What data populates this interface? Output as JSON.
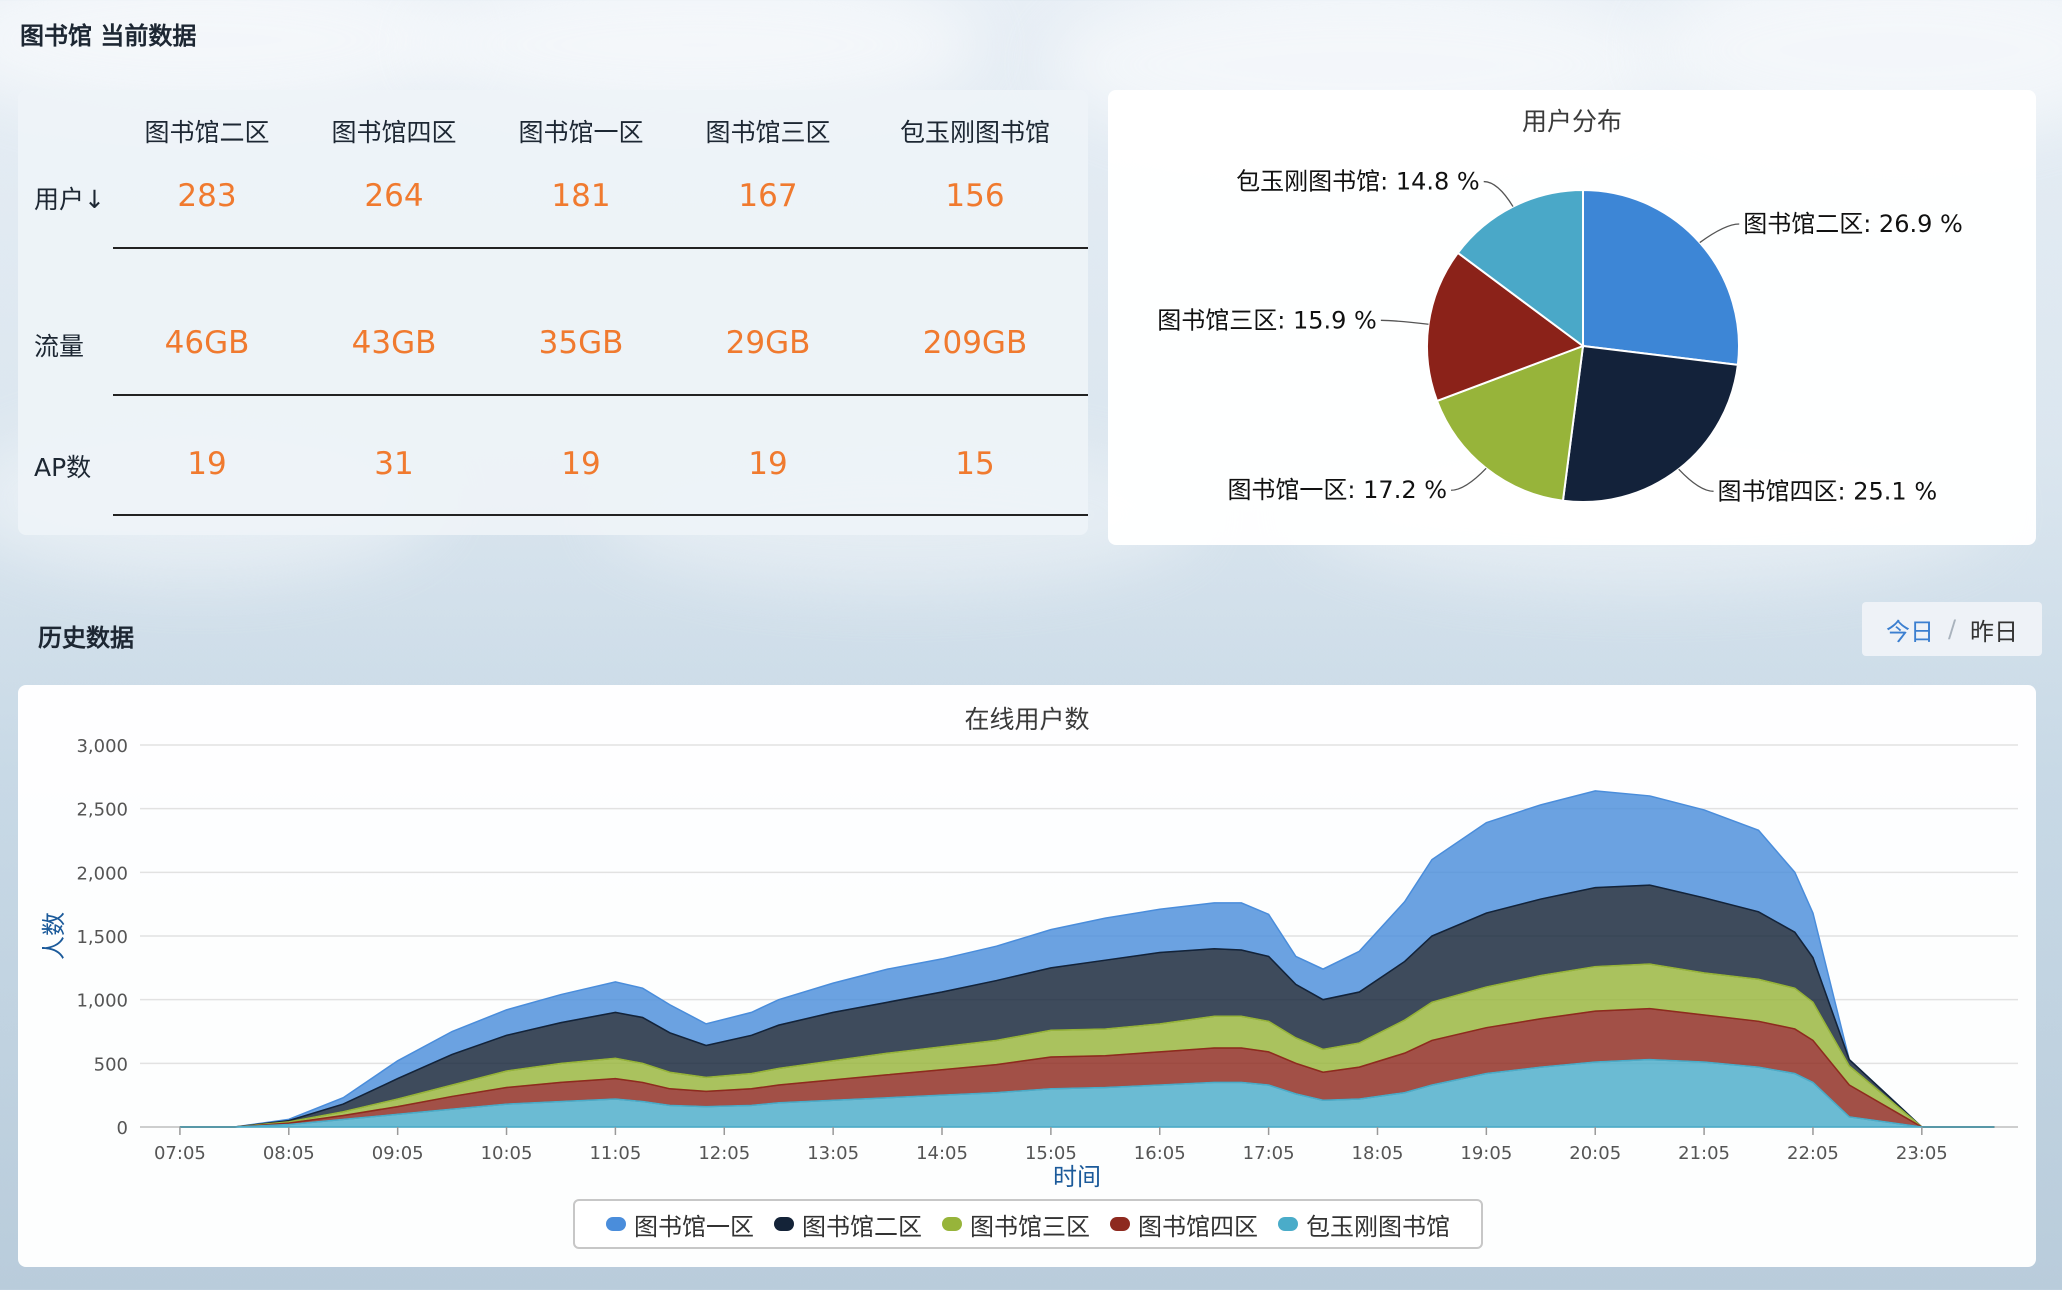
{
  "header": {
    "current_title": "图书馆 当前数据",
    "history_title": "历史数据"
  },
  "stats": {
    "columns": [
      "图书馆二区",
      "图书馆四区",
      "图书馆一区",
      "图书馆三区",
      "包玉刚图书馆"
    ],
    "rows": [
      {
        "label": "用户↓",
        "values": [
          "283",
          "264",
          "181",
          "167",
          "156"
        ]
      },
      {
        "label": "流量",
        "values": [
          "46GB",
          "43GB",
          "35GB",
          "29GB",
          "209GB"
        ]
      },
      {
        "label": "AP数",
        "values": [
          "19",
          "31",
          "19",
          "19",
          "15"
        ]
      }
    ]
  },
  "toggle": {
    "today": "今日",
    "sep": "/",
    "yesterday": "昨日"
  },
  "colors": {
    "图书馆一区": "#4a8ddb",
    "图书馆二区": "#142338",
    "图书馆三区": "#97b43a",
    "图书馆四区": "#8e2a1f",
    "包玉刚图书馆": "#4aacc9"
  },
  "chart_data": [
    {
      "type": "pie",
      "title": "用户分布",
      "labels": [
        "图书馆二区",
        "图书馆四区",
        "图书馆一区",
        "图书馆三区",
        "包玉刚图书馆"
      ],
      "values": [
        26.9,
        25.1,
        17.2,
        15.9,
        14.8
      ],
      "label_texts": [
        "图书馆二区: 26.9 %",
        "图书馆四区: 25.1 %",
        "图书馆一区: 17.2 %",
        "图书馆三区: 15.9 %",
        "包玉刚图书馆: 14.8 %"
      ],
      "colors": [
        "#3d86d6",
        "#13223a",
        "#97b43a",
        "#8b2219",
        "#4aa8c8"
      ]
    },
    {
      "type": "area",
      "stacked": true,
      "title": "在线用户数",
      "xlabel": "时间",
      "ylabel": "人数",
      "ylim": [
        0,
        3000
      ],
      "yticks": [
        0,
        500,
        1000,
        1500,
        2000,
        2500,
        3000
      ],
      "ytick_labels": [
        "0",
        "500",
        "1,000",
        "1,500",
        "2,000",
        "2,500",
        "3,000"
      ],
      "x_tick_labels": [
        "07:05",
        "08:05",
        "09:05",
        "10:05",
        "11:05",
        "12:05",
        "13:05",
        "14:05",
        "15:05",
        "16:05",
        "17:05",
        "18:05",
        "19:05",
        "20:05",
        "21:05",
        "22:05",
        "23:05"
      ],
      "x": [
        "07:05",
        "07:35",
        "08:05",
        "08:35",
        "09:05",
        "09:35",
        "10:05",
        "10:35",
        "11:05",
        "11:20",
        "11:35",
        "11:55",
        "12:20",
        "12:35",
        "13:05",
        "13:35",
        "14:05",
        "14:35",
        "15:05",
        "15:35",
        "16:05",
        "16:35",
        "16:50",
        "17:05",
        "17:20",
        "17:35",
        "17:55",
        "18:20",
        "18:35",
        "19:05",
        "19:35",
        "20:05",
        "20:35",
        "21:05",
        "21:35",
        "21:55",
        "22:05",
        "22:25",
        "23:05",
        "23:45"
      ],
      "legend": [
        "图书馆一区",
        "图书馆二区",
        "图书馆三区",
        "图书馆四区",
        "包玉刚图书馆"
      ],
      "series": [
        {
          "name": "包玉刚图书馆",
          "values": [
            0,
            0,
            20,
            60,
            100,
            140,
            180,
            200,
            220,
            200,
            170,
            160,
            170,
            190,
            210,
            230,
            250,
            270,
            300,
            310,
            330,
            350,
            350,
            330,
            260,
            210,
            220,
            270,
            330,
            420,
            470,
            510,
            530,
            510,
            470,
            420,
            350,
            80,
            0,
            0
          ]
        },
        {
          "name": "图书馆四区",
          "values": [
            0,
            0,
            10,
            30,
            60,
            100,
            130,
            150,
            160,
            150,
            130,
            120,
            130,
            140,
            160,
            180,
            200,
            220,
            250,
            250,
            260,
            270,
            270,
            260,
            240,
            220,
            250,
            310,
            350,
            360,
            380,
            400,
            400,
            370,
            360,
            350,
            330,
            250,
            0,
            0
          ]
        },
        {
          "name": "图书馆三区",
          "values": [
            0,
            0,
            10,
            30,
            60,
            90,
            130,
            150,
            160,
            150,
            130,
            110,
            120,
            130,
            150,
            170,
            180,
            190,
            210,
            210,
            220,
            250,
            250,
            240,
            200,
            180,
            190,
            260,
            300,
            320,
            340,
            350,
            350,
            330,
            330,
            320,
            300,
            150,
            0,
            0
          ]
        },
        {
          "name": "图书馆二区",
          "values": [
            0,
            0,
            10,
            60,
            160,
            240,
            280,
            320,
            360,
            360,
            310,
            250,
            300,
            340,
            380,
            400,
            430,
            470,
            490,
            540,
            560,
            530,
            520,
            510,
            420,
            390,
            400,
            460,
            520,
            580,
            600,
            620,
            620,
            590,
            530,
            440,
            350,
            50,
            0,
            0
          ]
        },
        {
          "name": "图书馆一区",
          "values": [
            0,
            0,
            10,
            50,
            140,
            180,
            200,
            220,
            240,
            230,
            220,
            170,
            180,
            200,
            230,
            260,
            260,
            270,
            300,
            330,
            340,
            360,
            370,
            330,
            220,
            240,
            320,
            470,
            600,
            710,
            740,
            760,
            700,
            690,
            640,
            470,
            350,
            0,
            0,
            0
          ]
        }
      ]
    }
  ]
}
